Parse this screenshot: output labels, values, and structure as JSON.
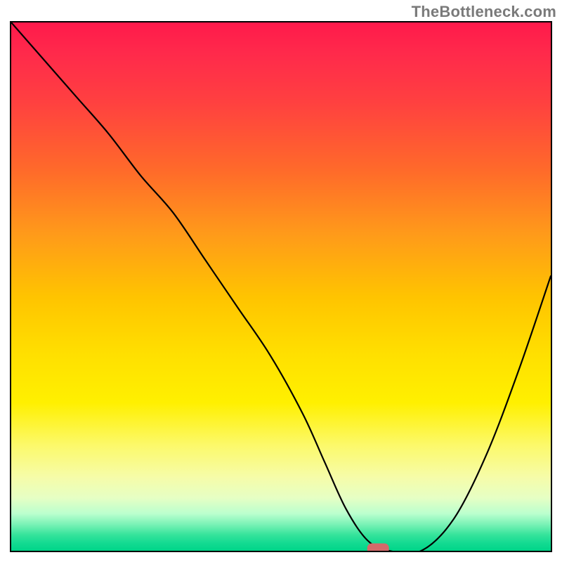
{
  "watermark": {
    "text": "TheBottleneck.com"
  },
  "chart_data": {
    "type": "line",
    "title": "",
    "xlabel": "",
    "ylabel": "",
    "xlim": [
      0,
      100
    ],
    "ylim": [
      0,
      100
    ],
    "grid": false,
    "legend": false,
    "background": "red-to-green vertical heat gradient",
    "series": [
      {
        "name": "bottleneck-curve",
        "x": [
          0,
          6,
          12,
          18,
          24,
          30,
          36,
          42,
          48,
          54,
          58,
          62,
          66,
          70,
          76,
          82,
          88,
          94,
          100
        ],
        "y": [
          100,
          93,
          86,
          79,
          71,
          64,
          55,
          46,
          37,
          26,
          17,
          8,
          2,
          0,
          0,
          6,
          18,
          34,
          52
        ]
      }
    ],
    "marker": {
      "x": 68,
      "y": 0,
      "shape": "rounded-rect",
      "color": "#d46a6a"
    }
  }
}
